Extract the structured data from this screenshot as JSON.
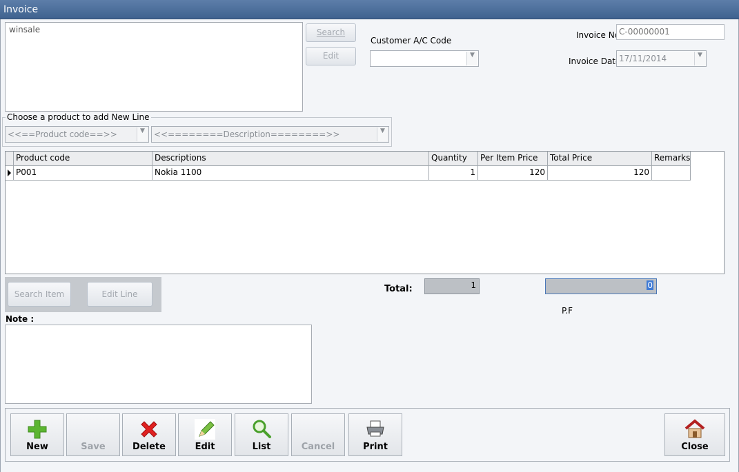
{
  "window": {
    "title": "Invoice"
  },
  "customer_box": {
    "text": "winsale"
  },
  "buttons": {
    "search": "Search",
    "edit": "Edit",
    "search_item": "Search Item",
    "edit_line": "Edit Line"
  },
  "customer": {
    "label": "Customer A/C Code",
    "value": ""
  },
  "invoice": {
    "no_label": "Invoice No",
    "no_value": "C-00000001",
    "date_label": "Invoice Date",
    "date_value": "17/11/2014"
  },
  "product_chooser": {
    "label": "Choose a product to add New Line",
    "code_placeholder": "<<==Product code==>>",
    "desc_placeholder": "<<========Description========>>"
  },
  "grid": {
    "columns": [
      "Product code",
      "Descriptions",
      "Quantity",
      "Per Item Price",
      "Total Price",
      "Remarks"
    ],
    "rows": [
      {
        "code": "P001",
        "description": "Nokia 1100",
        "quantity": "1",
        "unit_price": "120",
        "total_price": "120",
        "remarks": ""
      }
    ]
  },
  "totals": {
    "label": "Total:",
    "quantity": "1",
    "amount": "0",
    "pf_label": "P.F"
  },
  "note": {
    "label": "Note :",
    "value": ""
  },
  "toolbar": {
    "new": "New",
    "save": "Save",
    "delete": "Delete",
    "edit": "Edit",
    "list": "List",
    "cancel": "Cancel",
    "print": "Print",
    "close": "Close"
  },
  "colors": {
    "titlebar": "#4a6b96",
    "new_icon": "#5cb531",
    "delete_icon": "#e02020"
  }
}
